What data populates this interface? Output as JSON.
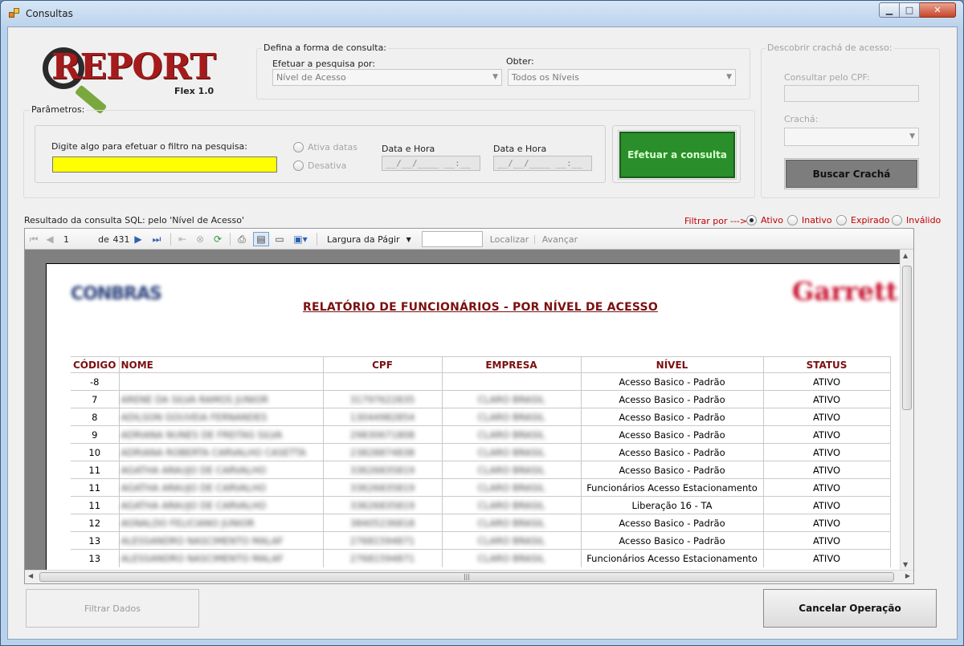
{
  "window": {
    "title": "Consultas"
  },
  "logo": {
    "text": "REPORT",
    "subtitle": "Flex 1.0"
  },
  "query_mode": {
    "group_label": "Defina a forma de consulta:",
    "search_by_label": "Efetuar a pesquisa por:",
    "search_by_value": "Nível de Acesso",
    "obtain_label": "Obter:",
    "obtain_value": "Todos os Níveis"
  },
  "params": {
    "group_label": "Parâmetros:",
    "filter_label": "Digite algo para efetuar o filtro na pesquisa:",
    "filter_value": "",
    "radio_enable_dates": "Ativa datas",
    "radio_disable": "Desativa",
    "date_from_label": "Data e Hora",
    "date_from_value": "__/__/____ __:__",
    "date_to_label": "Data e Hora",
    "date_to_value": "__/__/____ __:__",
    "run_button": "Efetuar a consulta"
  },
  "badge": {
    "group_label": "Descobrir crachá de acesso:",
    "cpf_label": "Consultar pelo CPF:",
    "badge_label": "Crachá:",
    "search_button": "Buscar Crachá"
  },
  "result": {
    "caption": "Resultado da consulta SQL: pelo 'Nível de Acesso'",
    "filter_by": "Filtrar por",
    "filter_arrow": "--->>",
    "filters": [
      "Ativo",
      "Inativo",
      "Expirado",
      "Inválido"
    ],
    "filter_selected": "Ativo"
  },
  "viewer_toolbar": {
    "page_current": "1",
    "page_of": "de",
    "page_total": "431",
    "zoom": "Largura da Págir",
    "find": "Localizar",
    "next": "Avançar"
  },
  "report": {
    "title": "RELATÓRIO DE FUNCIONÁRIOS - POR NÍVEL DE ACESSO",
    "left_logo": "CONBRAS",
    "right_logo": "Garrett",
    "columns": [
      "CÓDIGO",
      "NOME",
      "CPF",
      "EMPRESA",
      "NÍVEL",
      "STATUS"
    ],
    "rows": [
      {
        "codigo": "-8",
        "nome": "",
        "cpf": "",
        "empresa": "",
        "nivel": "Acesso Basico - Padrão",
        "status": "ATIVO"
      },
      {
        "codigo": "7",
        "nome": "ARENE DA SILVA RAMOS JUNIOR",
        "cpf": "31797622835",
        "empresa": "CLARO BRASIL",
        "nivel": "Acesso Basico - Padrão",
        "status": "ATIVO"
      },
      {
        "codigo": "8",
        "nome": "ADILSON GOUVEIA FERNANDES",
        "cpf": "13044982854",
        "empresa": "CLARO BRASIL",
        "nivel": "Acesso Basico - Padrão",
        "status": "ATIVO"
      },
      {
        "codigo": "9",
        "nome": "ADRIANA NUNES DE FREITAS SILVA",
        "cpf": "29830671808",
        "empresa": "CLARO BRASIL",
        "nivel": "Acesso Basico - Padrão",
        "status": "ATIVO"
      },
      {
        "codigo": "10",
        "nome": "ADRIANA ROBERTA CARVALHO CASETTA",
        "cpf": "23828874838",
        "empresa": "CLARO BRASIL",
        "nivel": "Acesso Basico - Padrão",
        "status": "ATIVO"
      },
      {
        "codigo": "11",
        "nome": "AGATHA ARAUJO DE CARVALHO",
        "cpf": "33626835819",
        "empresa": "CLARO BRASIL",
        "nivel": "Acesso Basico - Padrão",
        "status": "ATIVO"
      },
      {
        "codigo": "11",
        "nome": "AGATHA ARAUJO DE CARVALHO",
        "cpf": "33626835819",
        "empresa": "CLARO BRASIL",
        "nivel": "Funcionários Acesso Estacionamento",
        "status": "ATIVO"
      },
      {
        "codigo": "11",
        "nome": "AGATHA ARAUJO DE CARVALHO",
        "cpf": "33626835819",
        "empresa": "CLARO BRASIL",
        "nivel": "Liberação 16 - TA",
        "status": "ATIVO"
      },
      {
        "codigo": "12",
        "nome": "AGNALDO FELICIANO JUNIOR",
        "cpf": "38405236818",
        "empresa": "CLARO BRASIL",
        "nivel": "Acesso Basico - Padrão",
        "status": "ATIVO"
      },
      {
        "codigo": "13",
        "nome": "ALESSANDRO NASCIMENTO MALAF",
        "cpf": "27681594871",
        "empresa": "CLARO BRASIL",
        "nivel": "Acesso Basico - Padrão",
        "status": "ATIVO"
      },
      {
        "codigo": "13",
        "nome": "ALESSANDRO NASCIMENTO MALAF",
        "cpf": "27681594871",
        "empresa": "CLARO BRASIL",
        "nivel": "Funcionários Acesso Estacionamento",
        "status": "ATIVO"
      }
    ]
  },
  "footer": {
    "filter_button": "Filtrar Dados",
    "cancel_button": "Cancelar Operação"
  },
  "colors": {
    "accent_red": "#c00000",
    "report_title": "#7b1010",
    "run_button": "#2a8f2a",
    "filter_input": "#ffff00"
  }
}
